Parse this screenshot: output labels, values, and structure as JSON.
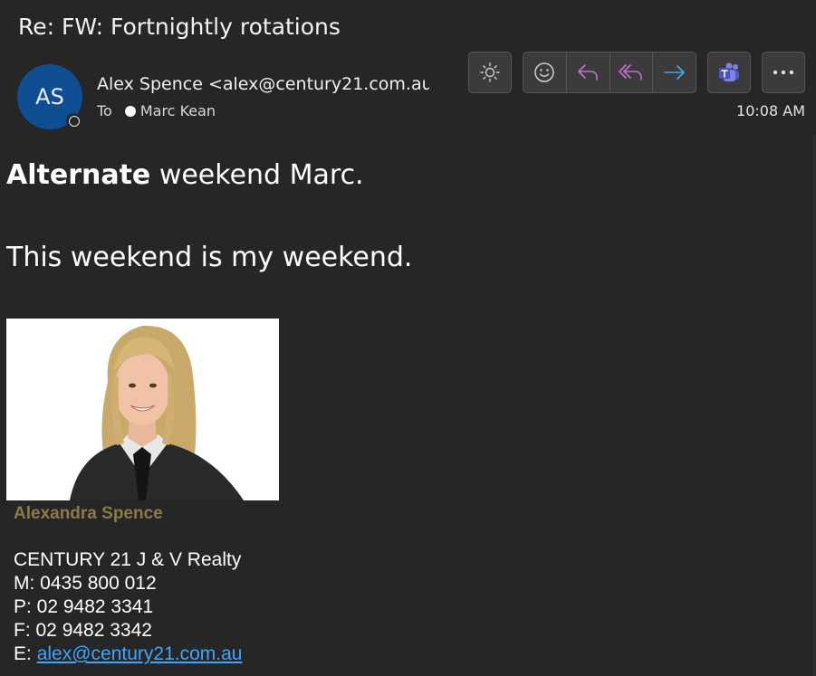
{
  "email": {
    "subject": "Re: FW: Fortnightly rotations",
    "avatar_initials": "AS",
    "sender": "Alex Spence <alex@century21.com.au",
    "to_label": "To",
    "recipient": "Marc Kean",
    "time": "10:08 AM"
  },
  "toolbar": {
    "icons": [
      "brightness-icon",
      "emoji-icon",
      "reply-icon",
      "reply-all-icon",
      "forward-icon",
      "teams-icon",
      "more-icon"
    ],
    "colors": {
      "reply": "#c56fd0",
      "forward": "#4aa3ee",
      "teams": "#7b83eb"
    }
  },
  "body": {
    "line1_bold": "Alternate",
    "line1_rest": " weekend Marc.",
    "line2": "This weekend is my weekend."
  },
  "signature": {
    "name": "Alexandra Spence",
    "company": "CENTURY 21 J & V Realty",
    "mobile": "M: 0435 800 012",
    "phone": "P: 02 9482 3341",
    "fax": "F: 02 9482 3342",
    "email_prefix": "E: ",
    "email_link": "alex@century21.com.au",
    "name_color": "#8a7b46",
    "link_color": "#3ea6ff"
  }
}
